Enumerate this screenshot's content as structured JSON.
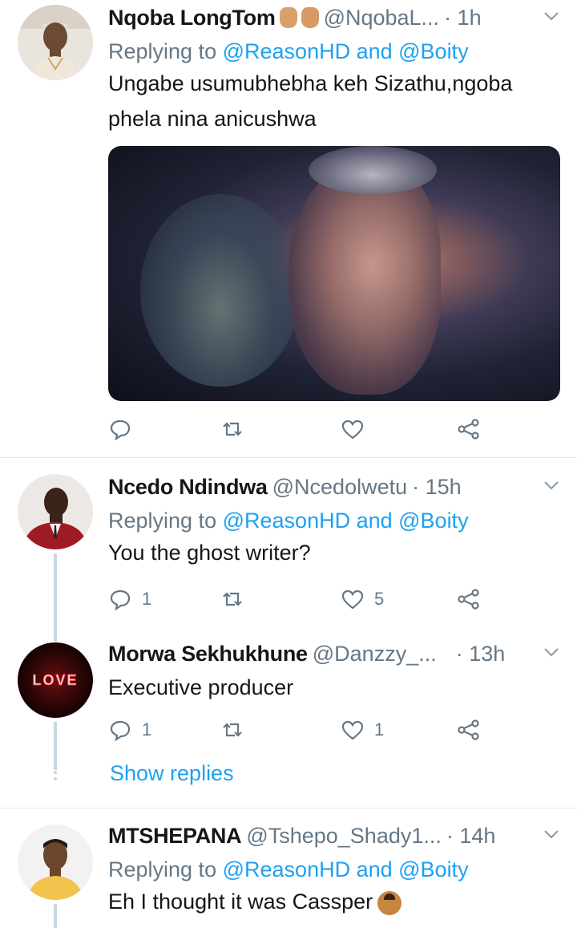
{
  "tweets": [
    {
      "name": "Nqoba LongTom",
      "emoji_icons": [
        "rock-on-hand-icon",
        "call-me-hand-icon"
      ],
      "handle": "@NqobaL...",
      "time": "· 1h",
      "replying_prefix": "Replying to",
      "replying_mentions": "@ReasonHD and @Boity",
      "text_line1": "Ungabe usumubhebha keh Sizathu,ngoba",
      "text_line2": "phela nina anicushwa",
      "counts": {
        "reply": "",
        "retweet": "",
        "like": ""
      }
    },
    {
      "name": "Ncedo Ndindwa",
      "handle": "@Ncedolwetu",
      "time": "· 15h",
      "replying_prefix": "Replying to",
      "replying_mentions": "@ReasonHD and @Boity",
      "text": "You the ghost writer?",
      "counts": {
        "reply": "1",
        "retweet": "",
        "like": "5"
      }
    },
    {
      "name": "Morwa Sekhukhune",
      "handle": "@Danzzy_...",
      "time": "· 13h",
      "text": "Executive producer",
      "avatar_text": "LOVE",
      "counts": {
        "reply": "1",
        "retweet": "",
        "like": "1"
      },
      "show_replies": "Show replies"
    },
    {
      "name": "MTSHEPANA",
      "handle": "@Tshepo_Shady1...",
      "time": "· 14h",
      "replying_prefix": "Replying to",
      "replying_mentions": "@ReasonHD and @Boity",
      "text": "Eh I thought it was Cassper",
      "trailing_emoji": "person-shrugging-emoji"
    }
  ],
  "colors": {
    "link": "#1da1f2",
    "muted": "#657786",
    "text": "#14171a",
    "divider": "#e1e8ed"
  }
}
